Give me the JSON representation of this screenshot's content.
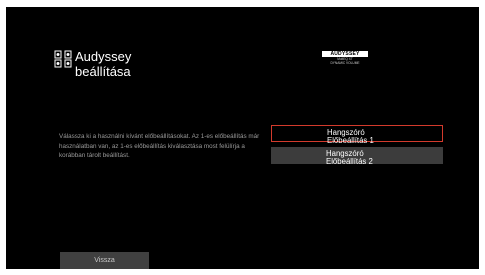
{
  "header": {
    "title_line1": "Audyssey",
    "title_line2": "beállítása",
    "icon": "speaker-setup-icon"
  },
  "logo": {
    "brand": "AUDYSSEY",
    "line1": "MultEQ XT",
    "line2": "DYNAMIC VOLUME"
  },
  "description": "Válassza ki a használni kívánt előbeállításokat. Az 1-es előbeállítás már használatban van, az 1-es előbeállítás kiválasztása most felülírja a korábban tárolt beállítást.",
  "options": [
    {
      "line1": "Hangszóró",
      "line2": "Előbeállítás 1"
    },
    {
      "line1": "Hangszóró",
      "line2": "Előbeállítás 2"
    }
  ],
  "back_label": "Vissza",
  "colors": {
    "selection_border": "#d33a2c",
    "background": "#000000"
  }
}
